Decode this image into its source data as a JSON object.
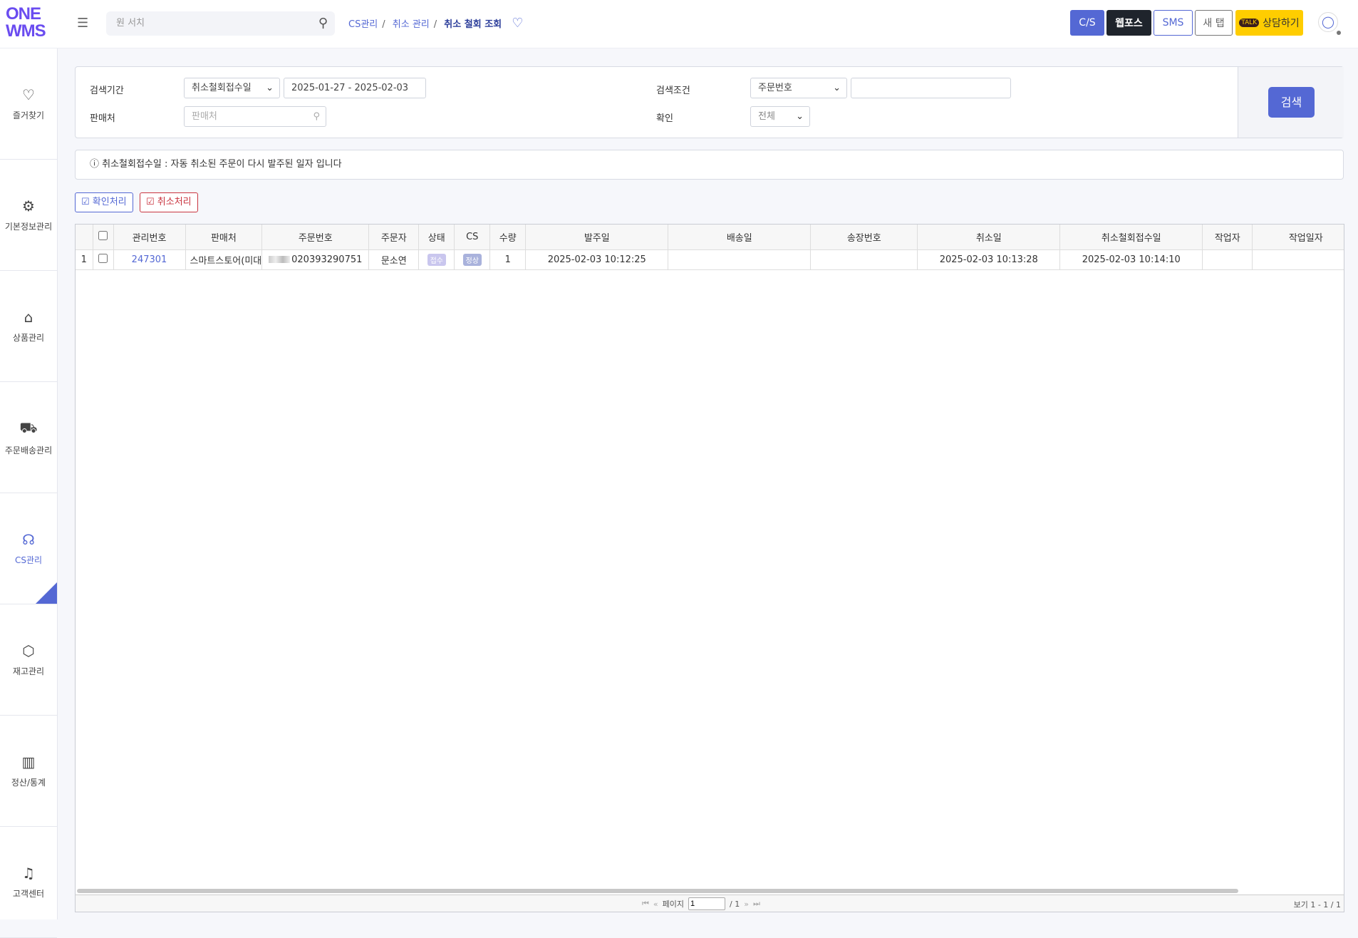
{
  "header": {
    "logo_line1": "ONE",
    "logo_line2": "WMS",
    "search_placeholder": "원 서치",
    "breadcrumb": [
      "CS관리",
      "취소 관리",
      "취소 철회 조회"
    ],
    "buttons": {
      "cs": "C/S",
      "webpos": "웹포스",
      "sms": "SMS",
      "new_tab": "새 탭",
      "chat": "상담하기"
    }
  },
  "sidebar": {
    "items": [
      {
        "label": "즐거찾기",
        "icon": "heart-icon"
      },
      {
        "label": "기본정보관리",
        "icon": "gear-icon"
      },
      {
        "label": "상품관리",
        "icon": "bag-icon"
      },
      {
        "label": "주문배송관리",
        "icon": "truck-icon"
      },
      {
        "label": "CS관리",
        "icon": "headset-icon",
        "active": true
      },
      {
        "label": "재고관리",
        "icon": "box-icon"
      },
      {
        "label": "정산/통계",
        "icon": "bar-chart-icon"
      },
      {
        "label": "고객센터",
        "icon": "bell-icon"
      }
    ]
  },
  "filters": {
    "period_label": "검색기간",
    "period_type": "취소철회접수일",
    "date_range": "2025-01-27 - 2025-02-03",
    "condition_label": "검색조건",
    "condition_type": "주문번호",
    "condition_value": "",
    "shop_label": "판매처",
    "shop_placeholder": "판매처",
    "confirm_label": "확인",
    "confirm_value": "전체",
    "search_button": "검색"
  },
  "info": "ⓘ 취소철회접수일 : 자동 취소된 주문이 다시 발주된 일자 입니다",
  "actions": {
    "confirm": "☑ 확인처리",
    "cancel": "☑ 취소처리"
  },
  "table": {
    "columns": [
      "",
      "",
      "관리번호",
      "판매처",
      "주문번호",
      "주문자",
      "상태",
      "CS",
      "수량",
      "발주일",
      "배송일",
      "송장번호",
      "취소일",
      "취소철회접수일",
      "작업자",
      "작업일자"
    ],
    "rows": [
      {
        "no": "1",
        "id": "247301",
        "shop": "스마트스토어(미대",
        "order_no": "020393290751",
        "buyer": "문소연",
        "status": "접수",
        "cs": "정상",
        "qty": "1",
        "order_date": "2025-02-03 10:12:25",
        "ship_date": "",
        "invoice": "",
        "cancel_date": "2025-02-03 10:13:28",
        "withdraw_date": "2025-02-03 10:14:10",
        "worker": "",
        "work_date": ""
      }
    ]
  },
  "pager": {
    "page_label": "페이지",
    "page": "1",
    "total": "/ 1",
    "view": "보기 1 - 1 / 1"
  },
  "colors": {
    "accent": "#5468d4",
    "logo": "#6a4cf0",
    "chat": "#ffcd00",
    "dark": "#1f242c"
  }
}
